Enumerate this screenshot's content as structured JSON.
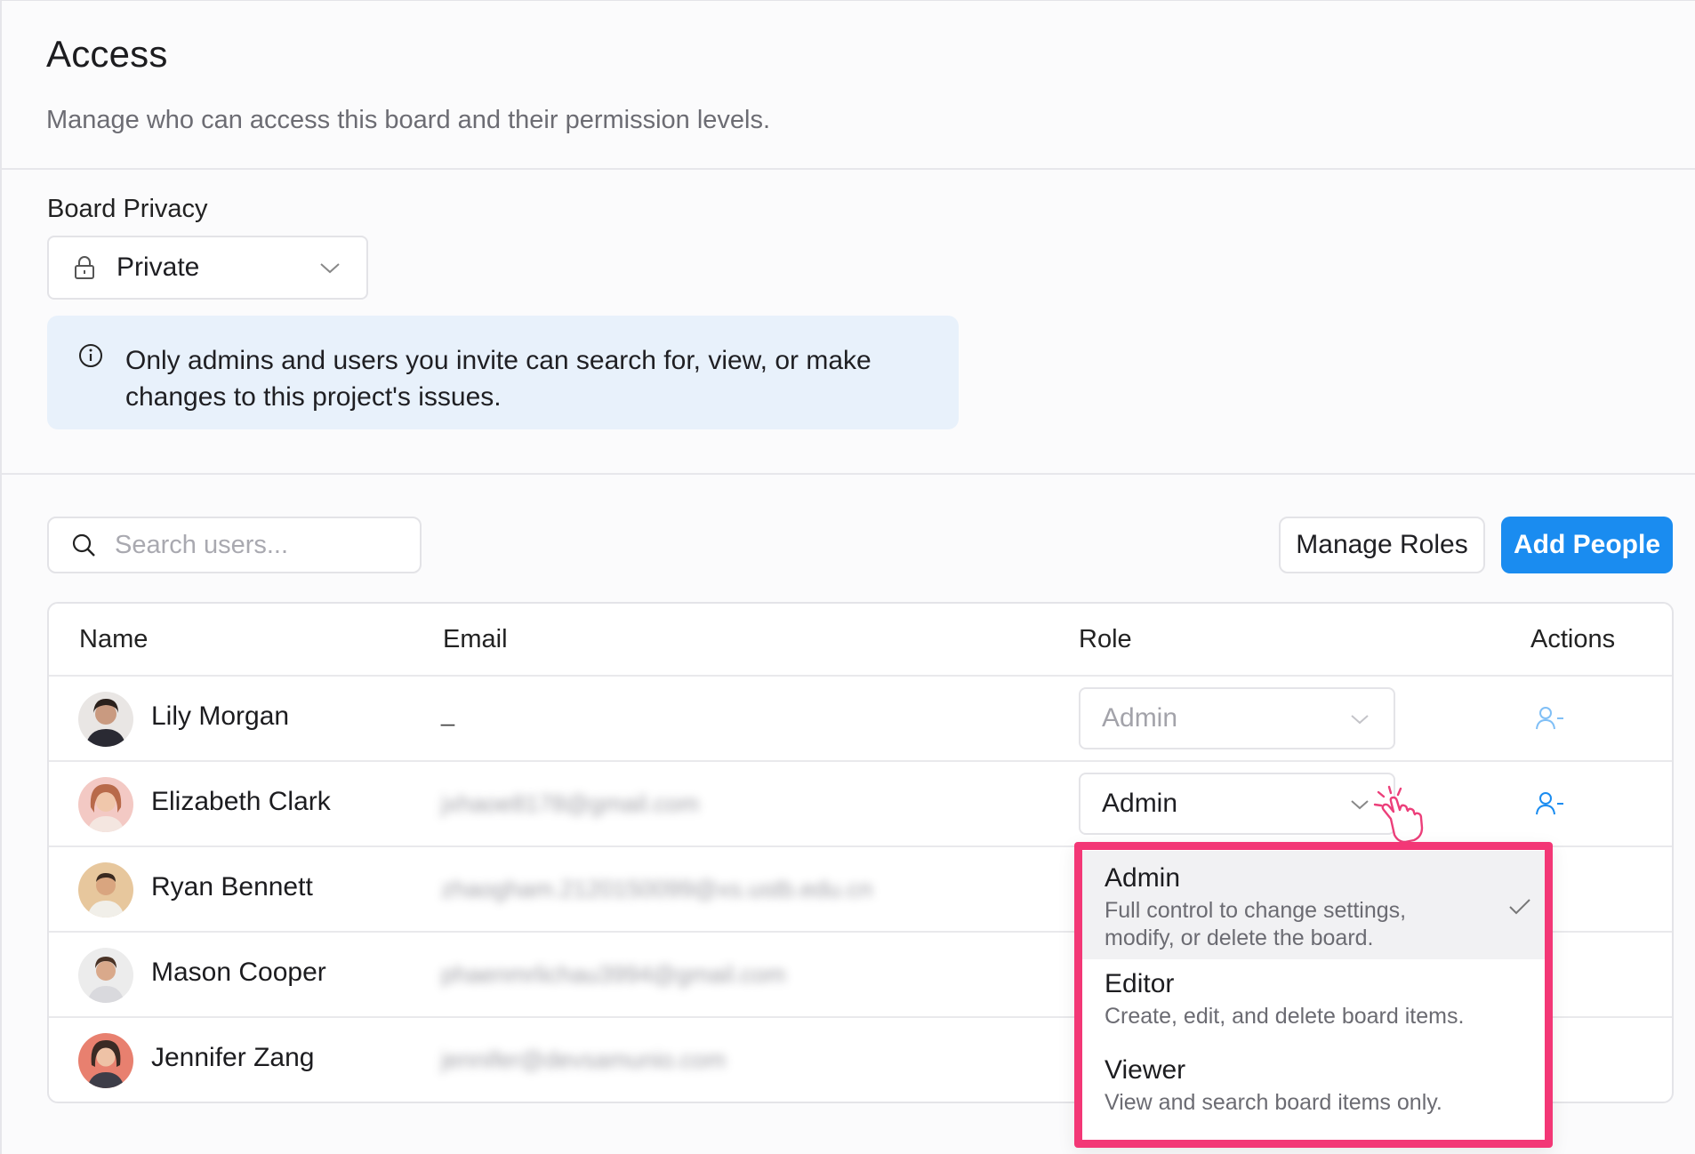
{
  "header": {
    "title": "Access",
    "subtitle": "Manage who can access this board and their permission levels."
  },
  "privacy": {
    "label": "Board Privacy",
    "value": "Private",
    "icon": "lock-icon",
    "info_icon": "info-icon",
    "info_text_line1": "Only admins and users you invite can search for, view, or make",
    "info_text_line2": "changes to this project's issues."
  },
  "toolbar": {
    "search_placeholder": "Search users...",
    "manage_roles_label": "Manage Roles",
    "add_people_label": "Add People",
    "accent_color": "#1a8cf0"
  },
  "table": {
    "headers": {
      "name": "Name",
      "email": "Email",
      "role": "Role",
      "actions": "Actions"
    },
    "rows": [
      {
        "name": "Lily Morgan",
        "email": "_",
        "role": "Admin",
        "role_disabled": true,
        "action_icon": "remove-user-icon"
      },
      {
        "name": "Elizabeth Clark",
        "email": "jxhaoe8178@gmail.com",
        "role": "Admin",
        "role_disabled": false,
        "action_icon": "remove-user-icon"
      },
      {
        "name": "Ryan Bennett",
        "email": "zhaogham.2120150099@xs.ustb.edu.cn",
        "role": "",
        "role_disabled": false,
        "action_icon": "remove-user-icon"
      },
      {
        "name": "Mason Cooper",
        "email": "phaenmrlichau3994@gmail.com",
        "role": "",
        "role_disabled": false,
        "action_icon": "remove-user-icon"
      },
      {
        "name": "Jennifer Zang",
        "email": "jennifer@devsamunio.com",
        "role": "",
        "role_disabled": false,
        "action_icon": "remove-user-icon"
      }
    ]
  },
  "role_dropdown": {
    "highlight_color": "#f33776",
    "options": [
      {
        "title": "Admin",
        "desc_line1": "Full control to change settings,",
        "desc_line2": "modify, or delete the board.",
        "selected": true
      },
      {
        "title": "Editor",
        "desc_line1": "Create, edit, and delete board items.",
        "selected": false
      },
      {
        "title": "Viewer",
        "desc_line1": "View and search board items only.",
        "selected": false
      }
    ]
  }
}
